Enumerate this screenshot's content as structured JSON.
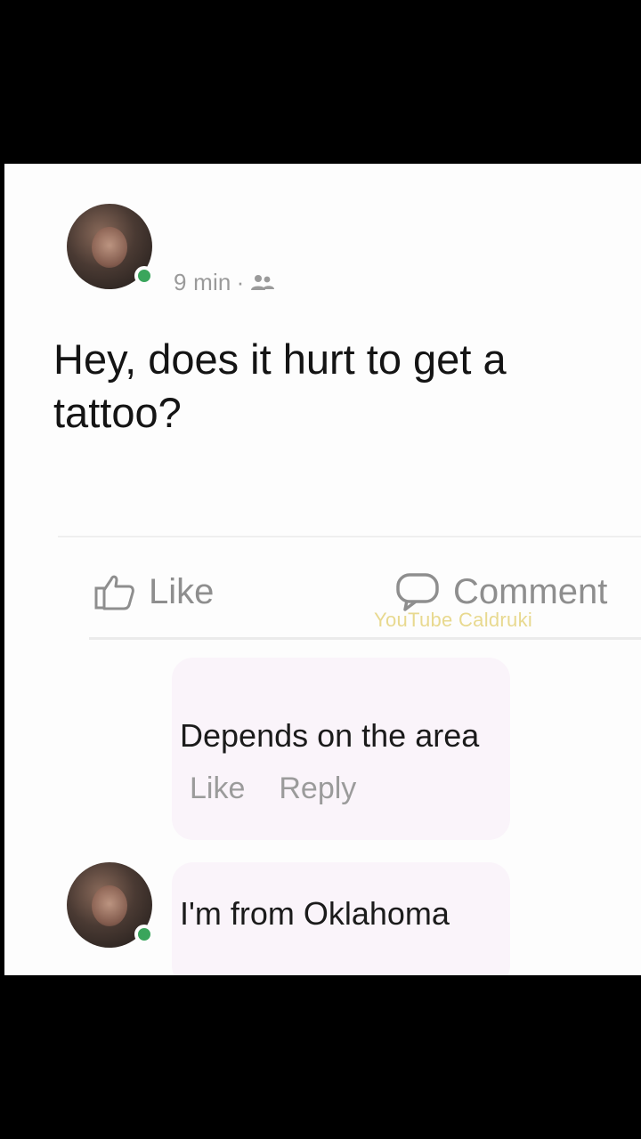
{
  "post": {
    "time": "9 min",
    "separator": "·",
    "privacy_icon": "friends-icon",
    "text": "Hey, does it hurt to get a tattoo?"
  },
  "actions": {
    "like_label": "Like",
    "comment_label": "Comment"
  },
  "watermark": "YouTube Caldruki",
  "comments": [
    {
      "text": "Depends on the area",
      "like_label": "Like",
      "reply_label": "Reply"
    },
    {
      "text": "I'm from Oklahoma"
    }
  ],
  "colors": {
    "online": "#3aa55c",
    "meta": "#9a9a9a",
    "bubble": "#faf4fa"
  }
}
